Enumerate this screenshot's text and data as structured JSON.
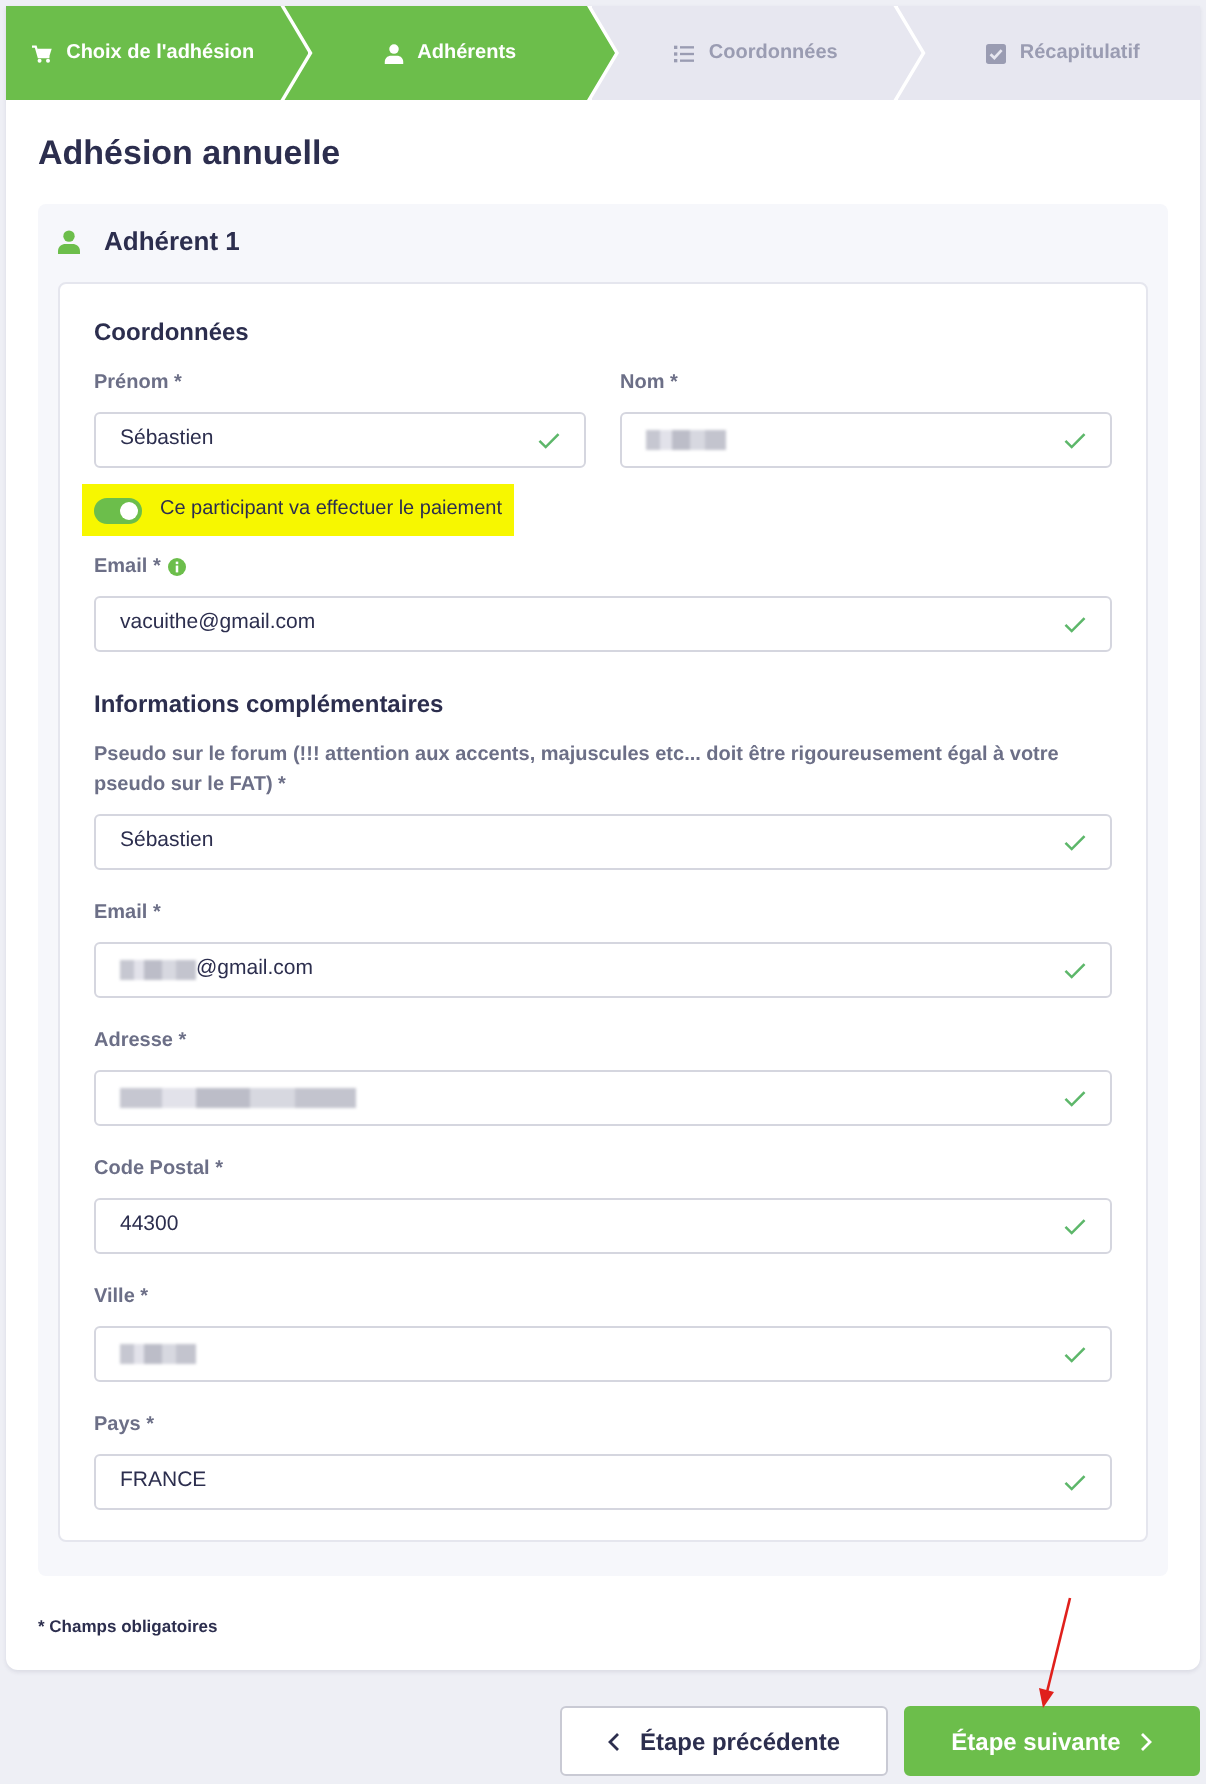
{
  "steps": [
    {
      "label": "Choix de l'adhésion",
      "reached": true
    },
    {
      "label": "Adhérents",
      "reached": true
    },
    {
      "label": "Coordonnées",
      "reached": false
    },
    {
      "label": "Récapitulatif",
      "reached": false
    }
  ],
  "title": "Adhésion annuelle",
  "member": {
    "title": "Adhérent 1",
    "sections": [
      {
        "title": "Coordonnées",
        "items": [
          {
            "kind": "field_row",
            "fields": [
              {
                "label": "Prénom *",
                "value": "Sébastien",
                "redacted": false,
                "info": false,
                "valid": true
              },
              {
                "label": "Nom *",
                "redacted": true,
                "info": false,
                "valid": true
              }
            ]
          },
          {
            "kind": "toggle",
            "label": "Ce participant va effectuer le paiement",
            "on": true,
            "highlighted": true
          },
          {
            "kind": "field",
            "label": "Email *",
            "value": "vacuithe@gmail.com",
            "redacted": false,
            "info": true,
            "valid": true
          }
        ]
      },
      {
        "title": "Informations complémentaires",
        "items": [
          {
            "kind": "field",
            "label": "Pseudo sur le forum (!!! attention aux accents, majuscules etc... doit être rigoureusement égal à votre pseudo sur le FAT) *",
            "value": "Sébastien",
            "redacted": false,
            "info": false,
            "valid": true
          },
          {
            "kind": "field",
            "label": "Email *",
            "value": "@gmail.com",
            "redacted": true,
            "info": false,
            "valid": true
          },
          {
            "kind": "field",
            "label": "Adresse *",
            "redacted": true,
            "info": false,
            "valid": true
          },
          {
            "kind": "field",
            "label": "Code Postal *",
            "value": "44300",
            "redacted": false,
            "info": false,
            "valid": true
          },
          {
            "kind": "field",
            "label": "Ville *",
            "redacted": true,
            "info": false,
            "valid": true
          },
          {
            "kind": "field",
            "label": "Pays *",
            "value": "FRANCE",
            "redacted": false,
            "info": false,
            "valid": true
          }
        ]
      }
    ]
  },
  "footnote": "* Champs obligatoires",
  "buttons": [
    {
      "label": "Étape précédente",
      "kind": "back"
    },
    {
      "label": "Étape suivante",
      "kind": "next"
    }
  ]
}
